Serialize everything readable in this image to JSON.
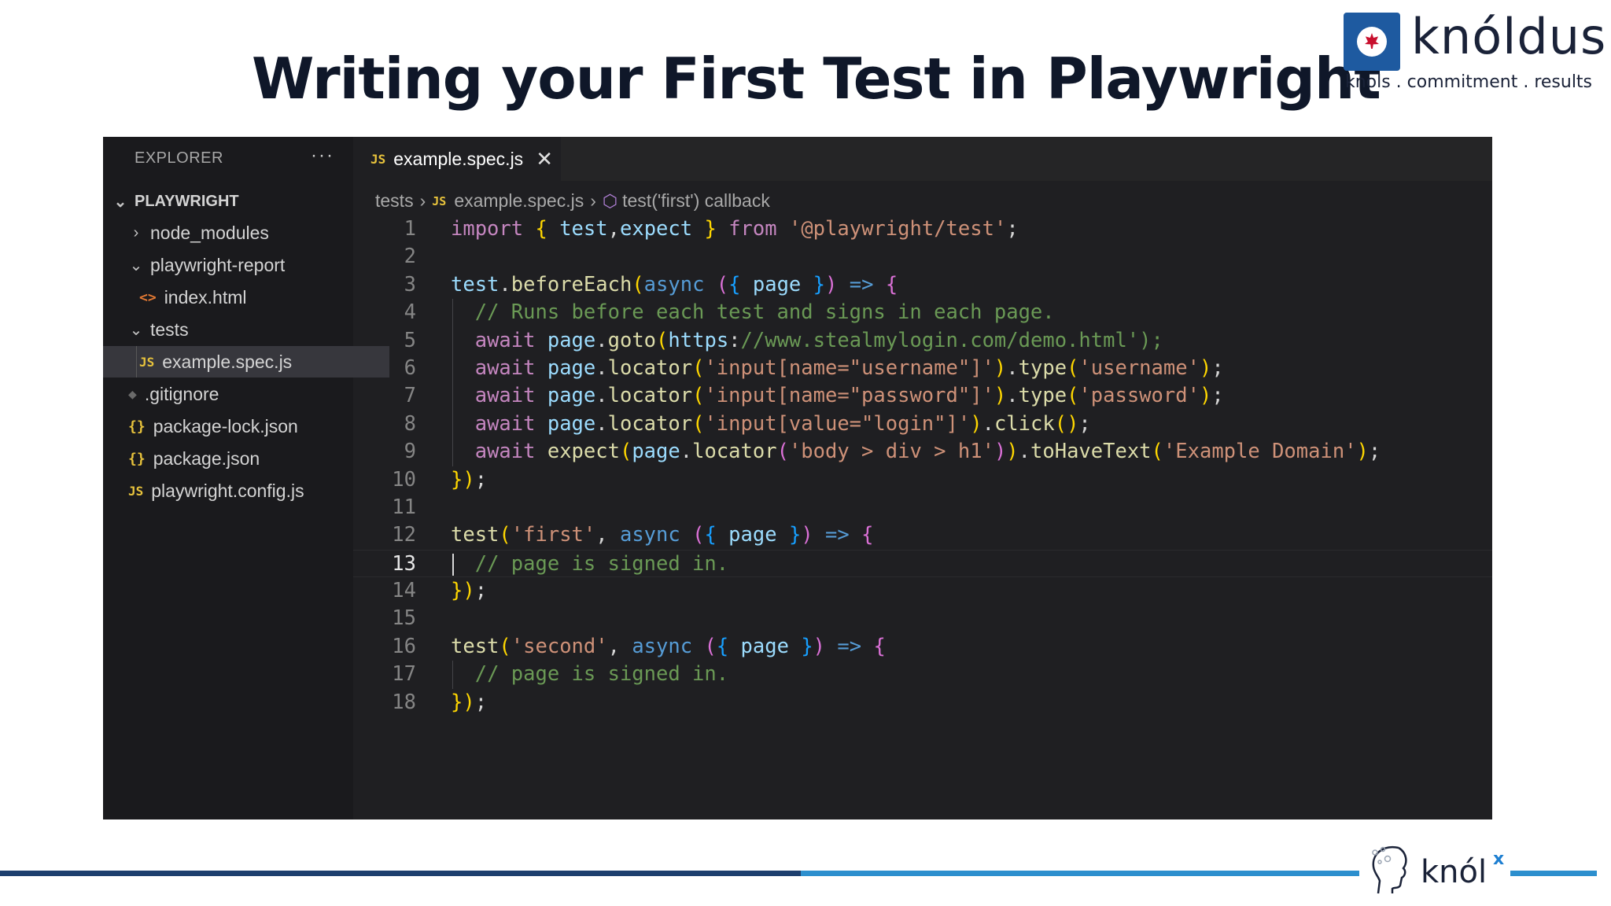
{
  "slide": {
    "title": "Writing your First Test in Playwright"
  },
  "brand": {
    "name": "knóldus",
    "tagline": "knols . commitment . results"
  },
  "explorer": {
    "header": "EXPLORER",
    "more": "···",
    "project": "PLAYWRIGHT",
    "items": [
      {
        "label": "node_modules",
        "type": "folder",
        "expanded": false
      },
      {
        "label": "playwright-report",
        "type": "folder",
        "expanded": true
      },
      {
        "label": "index.html",
        "type": "html-file"
      },
      {
        "label": "tests",
        "type": "folder",
        "expanded": true
      },
      {
        "label": "example.spec.js",
        "type": "js-file",
        "selected": true
      },
      {
        "label": ".gitignore",
        "type": "git-file"
      },
      {
        "label": "package-lock.json",
        "type": "json-file"
      },
      {
        "label": "package.json",
        "type": "json-file"
      },
      {
        "label": "playwright.config.js",
        "type": "js-file"
      }
    ]
  },
  "tab": {
    "icon": "JS",
    "label": "example.spec.js",
    "close": "✕"
  },
  "breadcrumb": {
    "folder": "tests",
    "file_icon": "JS",
    "file": "example.spec.js",
    "symbol": "test('first') callback"
  },
  "editor": {
    "current_line": 13,
    "lines": [
      "import { test,expect } from '@playwright/test';",
      "",
      "test.beforeEach(async ({ page }) => {",
      "  // Runs before each test and signs in each page.",
      "  await page.goto('https://www.stealmylogin.com/demo.html');",
      "  await page.locator('input[name=\"username\"]').type('username');",
      "  await page.locator('input[name=\"password\"]').type('password');",
      "  await page.locator('input[value=\"login\"]').click();",
      "  await expect(page.locator('body > div > h1')).toHaveText('Example Domain');",
      "});",
      "",
      "test('first', async ({ page }) => {",
      "  // page is signed in.",
      "});",
      "",
      "test('second', async ({ page }) => {",
      "  // page is signed in.",
      "});"
    ]
  },
  "footer": {
    "knolx_text": "knól",
    "knolx_sup": "x"
  },
  "colors": {
    "title": "#0f1729",
    "editor_bg": "#1f1f22",
    "sidebar_bg": "#1a1a1d",
    "footer_dark": "#1d3f6e",
    "footer_light": "#2c8fce"
  }
}
